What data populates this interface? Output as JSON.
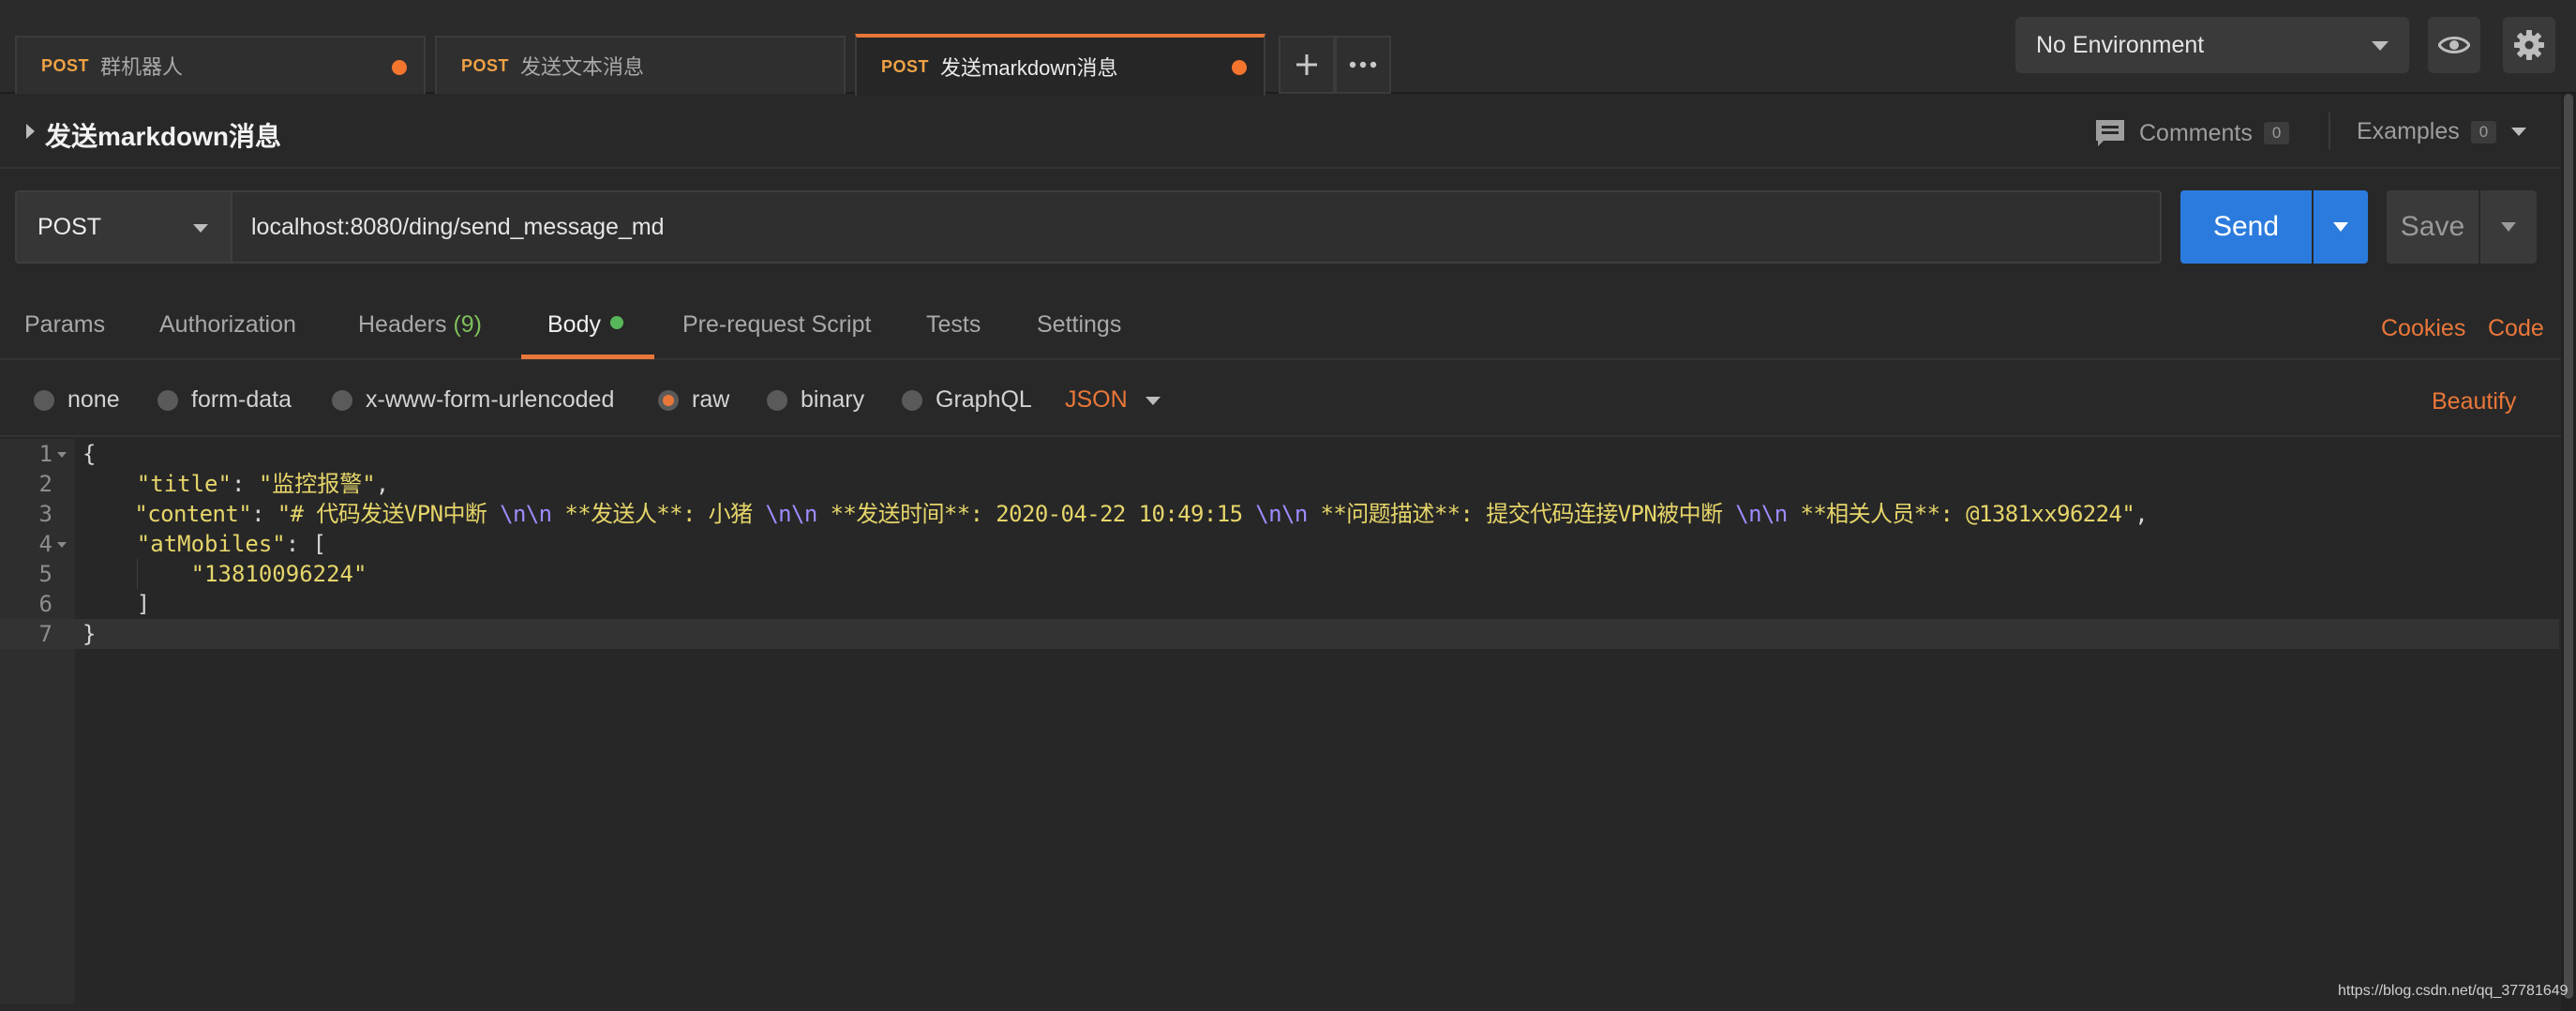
{
  "tabs": [
    {
      "method": "POST",
      "name": "群机器人",
      "modified": true
    },
    {
      "method": "POST",
      "name": "发送文本消息",
      "modified": false
    },
    {
      "method": "POST",
      "name": "发送markdown消息",
      "modified": true,
      "active": true
    }
  ],
  "tab_actions": {
    "new_tab_icon": "plus-icon",
    "more_icon": "more-dots-icon"
  },
  "environment": {
    "selected": "No Environment"
  },
  "header_icons": {
    "quick_look": "eye-icon",
    "settings": "gear-icon"
  },
  "request": {
    "title": "发送markdown消息",
    "comments_label": "Comments",
    "comments_count": "0",
    "examples_label": "Examples",
    "examples_count": "0",
    "method": "POST",
    "url": "localhost:8080/ding/send_message_md",
    "send_label": "Send",
    "save_label": "Save"
  },
  "subtabs": {
    "params": "Params",
    "authorization": "Authorization",
    "headers": "Headers",
    "headers_count": "(9)",
    "body": "Body",
    "pre_request": "Pre-request Script",
    "tests": "Tests",
    "settings": "Settings",
    "cookies": "Cookies",
    "code": "Code"
  },
  "body_types": {
    "none": "none",
    "form_data": "form-data",
    "urlencoded": "x-www-form-urlencoded",
    "raw": "raw",
    "binary": "binary",
    "graphql": "GraphQL",
    "selected": "raw",
    "format": "JSON",
    "beautify": "Beautify"
  },
  "editor": {
    "line_numbers": [
      "1",
      "2",
      "3",
      "4",
      "5",
      "6",
      "7"
    ],
    "lines": {
      "l1": "{",
      "l2_key": "\"title\"",
      "l2_val": "\"监控报警\"",
      "l3_key": "\"content\"",
      "l3_a": "\"# 代码发送VPN中断 ",
      "l3_b": " **发送人**: 小猪 ",
      "l3_c": " **发送时间**: 2020-04-22 10:49:15 ",
      "l3_d": " **问题描述**: 提交代码连接VPN被中断 ",
      "l3_e": " **相关人员**: @1381xx96224\"",
      "esc": "\\n\\n",
      "l4_key": "\"atMobiles\"",
      "l5_val": "\"13810096224\"",
      "l6": "]",
      "l7": "}"
    }
  },
  "watermark": "https://blog.csdn.net/qq_37781649"
}
